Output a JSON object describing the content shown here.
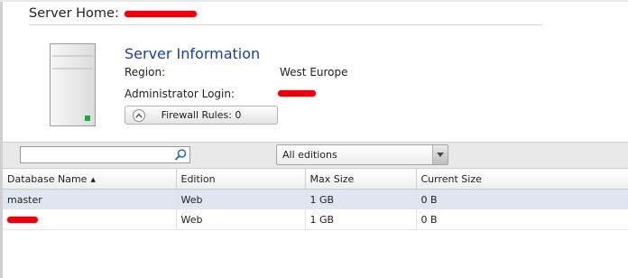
{
  "header": {
    "server_home_label": "Server Home:"
  },
  "server_info": {
    "title": "Server Information",
    "region_label": "Region:",
    "region_value": "West Europe",
    "admin_login_label": "Administrator Login:",
    "firewall_button_label": "Firewall Rules: 0"
  },
  "toolbar": {
    "search_value": "",
    "edition_filter": "All editions"
  },
  "table": {
    "columns": [
      "Database Name",
      "Edition",
      "Max Size",
      "Current Size"
    ],
    "rows": [
      {
        "name": "master",
        "edition": "Web",
        "max_size": "1 GB",
        "current_size": "0 B"
      },
      {
        "name": "",
        "edition": "Web",
        "max_size": "1 GB",
        "current_size": "0 B"
      }
    ]
  },
  "colors": {
    "title_blue": "#1a3f9b",
    "redaction_red": "#e5000f",
    "selected_row": "#dfe6ef"
  },
  "icons": {
    "server": "server-icon",
    "firewall_toggle": "chevron-up-circle-icon",
    "search": "search-icon",
    "dropdown": "chevron-down-icon",
    "sort": "sort-ascending-icon"
  }
}
